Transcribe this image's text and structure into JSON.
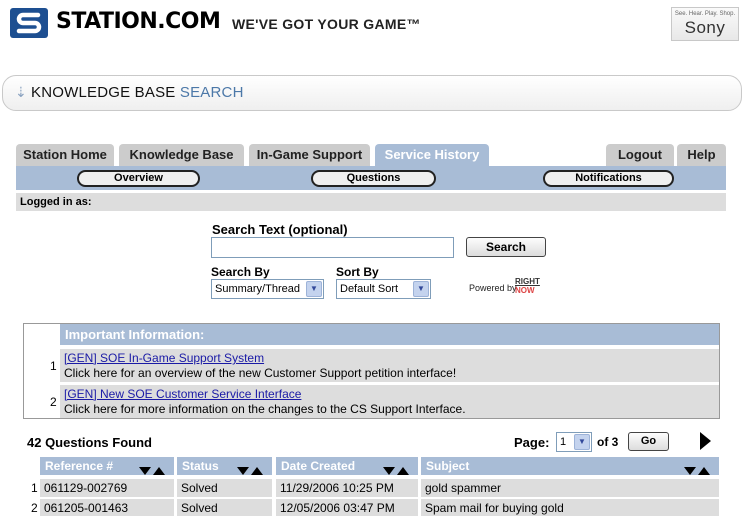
{
  "header": {
    "logo_text": "STATION.COM",
    "tagline": "WE'VE GOT YOUR GAME™",
    "sony_tagline": "See. Hear. Play. Shop.",
    "sony_name": "Sony"
  },
  "kb_bar": {
    "title_part1": "KNOWLEDGE BASE",
    "title_part2": "SEARCH"
  },
  "tabs": [
    {
      "label": "Station Home"
    },
    {
      "label": "Knowledge Base"
    },
    {
      "label": "In-Game Support"
    },
    {
      "label": "Service History"
    }
  ],
  "right_tabs": [
    {
      "label": "Logout"
    },
    {
      "label": "Help"
    }
  ],
  "subnav": [
    {
      "label": "Overview"
    },
    {
      "label": "Questions"
    },
    {
      "label": "Notifications"
    }
  ],
  "logged_in_label": "Logged in as:",
  "search": {
    "text_label": "Search Text (optional)",
    "input_value": "",
    "button_label": "Search",
    "search_by_label": "Search By",
    "search_by_value": "Summary/Thread",
    "sort_by_label": "Sort By",
    "sort_by_value": "Default Sort",
    "powered_by": "Powered by",
    "rightnow_1": "RIGHT",
    "rightnow_2": "NOW"
  },
  "important": {
    "heading": "Important Information:",
    "items": [
      {
        "num": "1",
        "link": "[GEN] SOE In-Game Support System",
        "desc": "Click here for an overview of the new Customer Support petition interface!"
      },
      {
        "num": "2",
        "link": "[GEN] New SOE Customer Service Interface",
        "desc": "Click here for more information on the changes to the CS Support Interface."
      }
    ]
  },
  "results": {
    "found_text": "42 Questions Found",
    "page_label": "Page:",
    "page_value": "1",
    "of_text": "of 3",
    "go_label": "Go",
    "columns": [
      "Reference #",
      "Status",
      "Date Created",
      "Subject"
    ],
    "rows": [
      {
        "num": "1",
        "ref": "061129-002769",
        "status": "Solved",
        "date": "11/29/2006 10:25 PM",
        "subject": "gold spammer"
      },
      {
        "num": "2",
        "ref": "061205-001463",
        "status": "Solved",
        "date": "12/05/2006 03:47 PM",
        "subject": "Spam mail for buying gold"
      }
    ]
  },
  "colors": {
    "accent": "#a8bcd6",
    "row_bg": "#dddddd",
    "tab_bg": "#cccccc",
    "link": "#1a1aa6"
  }
}
